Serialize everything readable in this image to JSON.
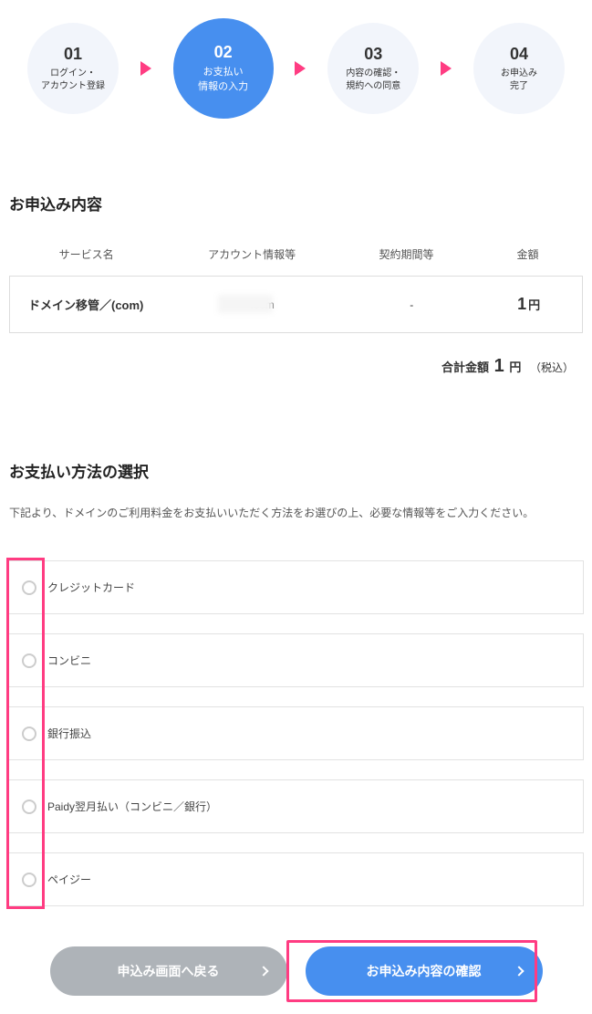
{
  "stepper": {
    "steps": [
      {
        "num": "01",
        "label": "ログイン・\nアカウント登録"
      },
      {
        "num": "02",
        "label": "お支払い\n情報の入力"
      },
      {
        "num": "03",
        "label": "内容の確認・\n規約への同意"
      },
      {
        "num": "04",
        "label": "お申込み\n完了"
      }
    ]
  },
  "order": {
    "title": "お申込み内容",
    "headers": {
      "service": "サービス名",
      "account": "アカウント情報等",
      "period": "契約期間等",
      "amount": "金額"
    },
    "row": {
      "service": "ドメイン移管／(com)",
      "account": ".com",
      "period": "-",
      "amount": "1",
      "currency": "円"
    },
    "total_label": "合計金額",
    "total_value": "1",
    "total_currency": "円",
    "total_tax": "（税込）"
  },
  "payment": {
    "title": "お支払い方法の選択",
    "desc": "下記より、ドメインのご利用料金をお支払いいただく方法をお選びの上、必要な情報等をご入力ください。",
    "options": [
      "クレジットカード",
      "コンビニ",
      "銀行振込",
      "Paidy翌月払い（コンビニ／銀行）",
      "ペイジー"
    ]
  },
  "buttons": {
    "back": "申込み画面へ戻る",
    "next": "お申込み内容の確認"
  }
}
